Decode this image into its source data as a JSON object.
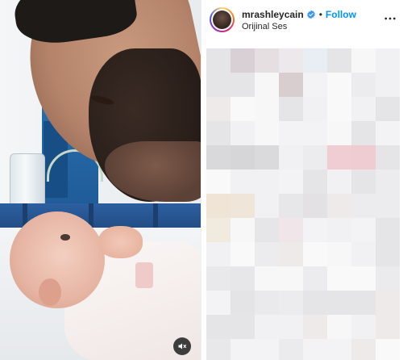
{
  "post": {
    "media": {
      "mute_icon": "speaker-muted-icon"
    },
    "header": {
      "username": "mrashleycain",
      "verified_icon": "verified-badge-icon",
      "separator": "•",
      "follow_label": "Follow",
      "audio_label": "Orijinal Ses",
      "more_icon": "more-horizontal-icon"
    },
    "colors": {
      "follow": "#0095f6",
      "text": "#262626",
      "verified": "#3897f0"
    }
  }
}
